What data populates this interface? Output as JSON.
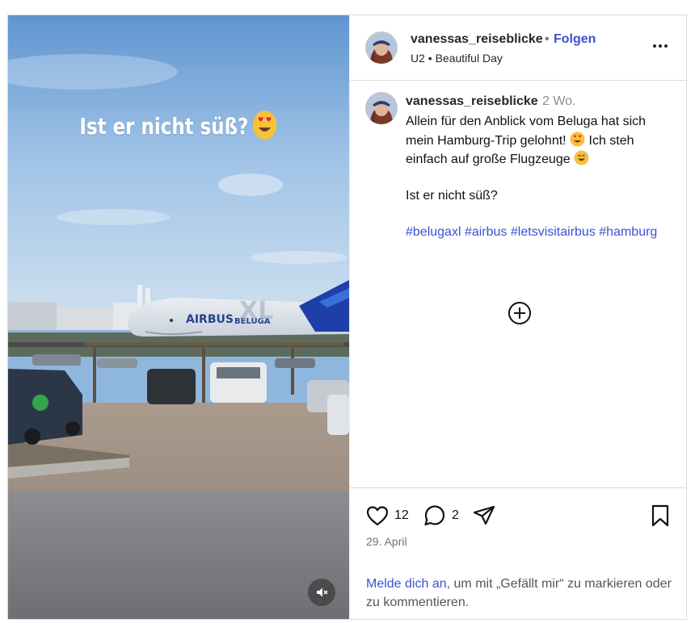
{
  "media": {
    "overlay_text": "Ist er nicht süß?",
    "overlay_emoji": "heart-eyes-emoji",
    "plane_brand": "AIRBUS",
    "plane_model": "BELUGA",
    "plane_tail_mark": "XL"
  },
  "header": {
    "username": "vanessas_reiseblicke",
    "separator": "•",
    "follow_label": "Folgen",
    "music_artist": "U2",
    "music_separator": "•",
    "music_title": "Beautiful Day"
  },
  "comment": {
    "username": "vanessas_reiseblicke",
    "time": "2 Wo.",
    "line1": "Allein für den Anblick vom Beluga hat sich mein Hamburg-Trip gelohnt!",
    "line1_after": "Ich steh einfach auf große Flugzeuge",
    "line2": "Ist er nicht süß?",
    "hashtags": [
      "#belugaxl",
      "#airbus",
      "#letsvisitairbus",
      "#hamburg"
    ]
  },
  "actions": {
    "likes": "12",
    "comments": "2",
    "date": "29. April"
  },
  "login": {
    "link_label": "Melde dich an",
    "text": ", um mit „Gefällt mir“ zu markieren oder zu kommentieren."
  },
  "colors": {
    "accent": "#3b51d4",
    "muted": "#737373",
    "border": "#dbdbdb"
  }
}
